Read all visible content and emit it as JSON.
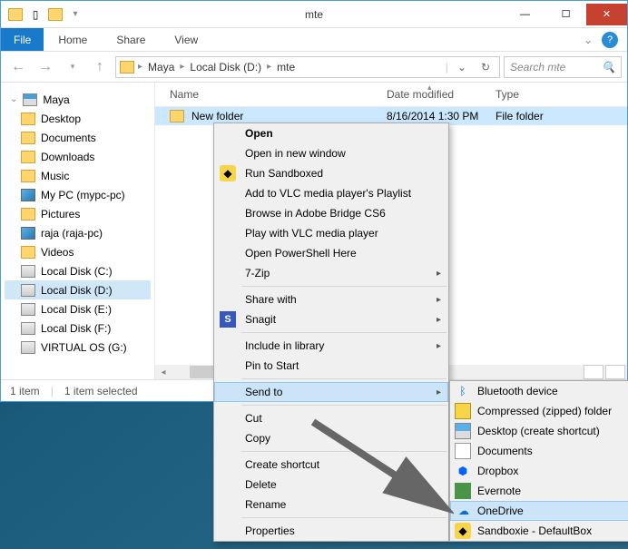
{
  "window": {
    "title": "mte",
    "file_tab": "File",
    "tabs": [
      "Home",
      "Share",
      "View"
    ]
  },
  "address": {
    "crumbs": [
      "Maya",
      "Local Disk (D:)",
      "mte"
    ],
    "search_placeholder": "Search mte"
  },
  "tree": {
    "root": "Maya",
    "items": [
      {
        "label": "Desktop",
        "icon": "folder"
      },
      {
        "label": "Documents",
        "icon": "folder"
      },
      {
        "label": "Downloads",
        "icon": "folder"
      },
      {
        "label": "Music",
        "icon": "folder"
      },
      {
        "label": "My PC (mypc-pc)",
        "icon": "network"
      },
      {
        "label": "Pictures",
        "icon": "folder"
      },
      {
        "label": "raja (raja-pc)",
        "icon": "network"
      },
      {
        "label": "Videos",
        "icon": "folder"
      },
      {
        "label": "Local Disk (C:)",
        "icon": "drive"
      },
      {
        "label": "Local Disk (D:)",
        "icon": "drive",
        "selected": true
      },
      {
        "label": "Local Disk (E:)",
        "icon": "drive"
      },
      {
        "label": "Local Disk (F:)",
        "icon": "drive"
      },
      {
        "label": "VIRTUAL OS (G:)",
        "icon": "drive"
      }
    ]
  },
  "columns": {
    "name": "Name",
    "date": "Date modified",
    "type": "Type"
  },
  "files": [
    {
      "name": "New folder",
      "date": "8/16/2014 1:30 PM",
      "type": "File folder",
      "selected": true
    }
  ],
  "status": {
    "count": "1 item",
    "selected": "1 item selected"
  },
  "context_menu": [
    {
      "label": "Open",
      "bold": true
    },
    {
      "label": "Open in new window"
    },
    {
      "label": "Run Sandboxed",
      "icon": "sandbox"
    },
    {
      "label": "Add to VLC media player's Playlist"
    },
    {
      "label": "Browse in Adobe Bridge CS6"
    },
    {
      "label": "Play with VLC media player"
    },
    {
      "label": "Open PowerShell Here"
    },
    {
      "label": "7-Zip",
      "submenu": true
    },
    {
      "sep": true
    },
    {
      "label": "Share with",
      "submenu": true
    },
    {
      "label": "Snagit",
      "icon": "snagit",
      "submenu": true
    },
    {
      "sep": true
    },
    {
      "label": "Include in library",
      "submenu": true
    },
    {
      "label": "Pin to Start"
    },
    {
      "sep": true
    },
    {
      "label": "Send to",
      "submenu": true,
      "hover": true
    },
    {
      "sep": true
    },
    {
      "label": "Cut"
    },
    {
      "label": "Copy"
    },
    {
      "sep": true
    },
    {
      "label": "Create shortcut"
    },
    {
      "label": "Delete"
    },
    {
      "label": "Rename"
    },
    {
      "sep": true
    },
    {
      "label": "Properties"
    }
  ],
  "send_to_menu": [
    {
      "label": "Bluetooth device",
      "icon": "bt"
    },
    {
      "label": "Compressed (zipped) folder",
      "icon": "zip"
    },
    {
      "label": "Desktop (create shortcut)",
      "icon": "desktop"
    },
    {
      "label": "Documents",
      "icon": "docs"
    },
    {
      "label": "Dropbox",
      "icon": "dropbox"
    },
    {
      "label": "Evernote",
      "icon": "evernote"
    },
    {
      "label": "OneDrive",
      "icon": "onedrive",
      "hover": true
    },
    {
      "label": "Sandboxie - DefaultBox",
      "icon": "sandboxie"
    }
  ]
}
